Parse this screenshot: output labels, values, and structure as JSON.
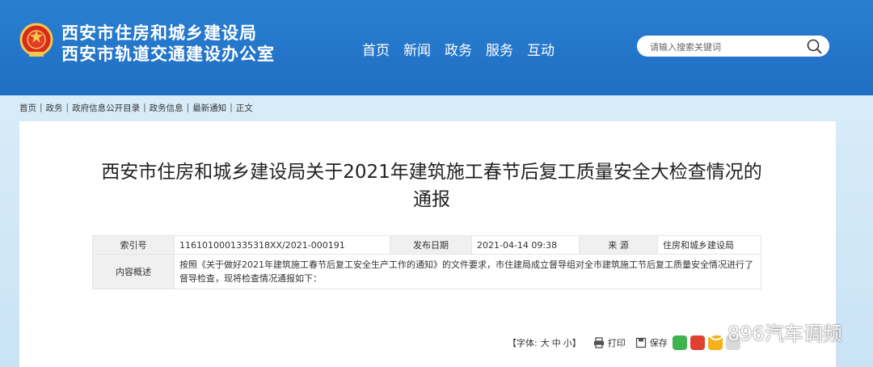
{
  "header": {
    "title_line1": "西安市住房和城乡建设局",
    "title_line2": "西安市轨道交通建设办公室",
    "nav": [
      "首页",
      "新闻",
      "政务",
      "服务",
      "互动"
    ],
    "search_placeholder": "请输入搜索关键词"
  },
  "breadcrumb": [
    "首页",
    "政务",
    "政府信息公开目录",
    "政务信息",
    "最新通知",
    "正文"
  ],
  "breadcrumb_sep": "|",
  "article": {
    "title": "西安市住房和城乡建设局关于2021年建筑施工春节后复工质量安全大检查情况的通报",
    "meta": {
      "index_label": "索引号",
      "index_value": "1161010001335318XX/2021-000191",
      "date_label": "发布日期",
      "date_value": "2021-04-14 09:38",
      "source_label": "来 源",
      "source_value": "住房和城乡建设局",
      "summary_label": "内容概述",
      "summary_value": "按照《关于做好2021年建筑施工春节后复工安全生产工作的通知》的文件要求，市住建局成立督导组对全市建筑施工节后复工质量安全情况进行了督导检查，现将检查情况通报如下："
    }
  },
  "toolbar": {
    "font_label": "【字体:",
    "size_large": "大",
    "size_medium": "中",
    "size_small": "小】",
    "print": "打印",
    "save": "保存"
  },
  "watermark": "896汽车调频",
  "colors": {
    "header_bg": "#1f6ec4",
    "band_bg": "#cfe6f6"
  }
}
